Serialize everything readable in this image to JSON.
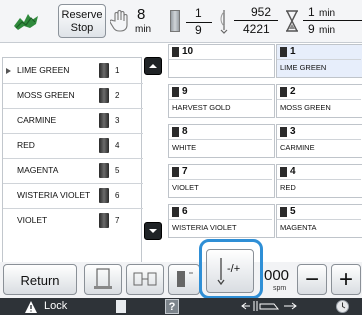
{
  "topbar": {
    "reserve_stop_line1": "Reserve",
    "reserve_stop_line2": "Stop",
    "min_value_1": "8",
    "min_unit": "min",
    "fraction_num": "1",
    "fraction_den": "9",
    "stitch_current": "952",
    "stitch_total": "4221",
    "time_top": "1",
    "time_top_unit": "min",
    "time_bottom": "9",
    "time_bottom_unit": "min"
  },
  "thread_list": [
    {
      "name": "LIME GREEN",
      "number": "1",
      "selected": true
    },
    {
      "name": "MOSS GREEN",
      "number": "2"
    },
    {
      "name": "CARMINE",
      "number": "3"
    },
    {
      "name": "RED",
      "number": "4"
    },
    {
      "name": "MAGENTA",
      "number": "5"
    },
    {
      "name": "WISTERIA VIOLET",
      "number": "6"
    },
    {
      "name": "VIOLET",
      "number": "7"
    }
  ],
  "grid": {
    "left_column": [
      {
        "number": "10",
        "color_name": ""
      },
      {
        "number": "9",
        "color_name": "HARVEST GOLD"
      },
      {
        "number": "8",
        "color_name": "WHITE"
      },
      {
        "number": "7",
        "color_name": "VIOLET"
      },
      {
        "number": "6",
        "color_name": "WISTERIA VIOLET"
      }
    ],
    "right_column": [
      {
        "number": "1",
        "color_name": "LIME GREEN"
      },
      {
        "number": "2",
        "color_name": "MOSS GREEN"
      },
      {
        "number": "3",
        "color_name": "CARMINE"
      },
      {
        "number": "4",
        "color_name": "RED"
      },
      {
        "number": "5",
        "color_name": "MAGENTA"
      }
    ]
  },
  "buttons": {
    "return_label": "Return",
    "speed_value": "000",
    "speed_unit": "spm",
    "minus_label": "−",
    "plus_label": "+",
    "needle_switch_label": "-/+"
  },
  "footer": {
    "lock_label": "Lock",
    "help_label": "?"
  },
  "colors": {
    "highlight_ring": "#2f8fd6",
    "footer_bg": "#2e3338",
    "selected_cell": "#e7eefb",
    "scroll_button": "#1f2326"
  }
}
